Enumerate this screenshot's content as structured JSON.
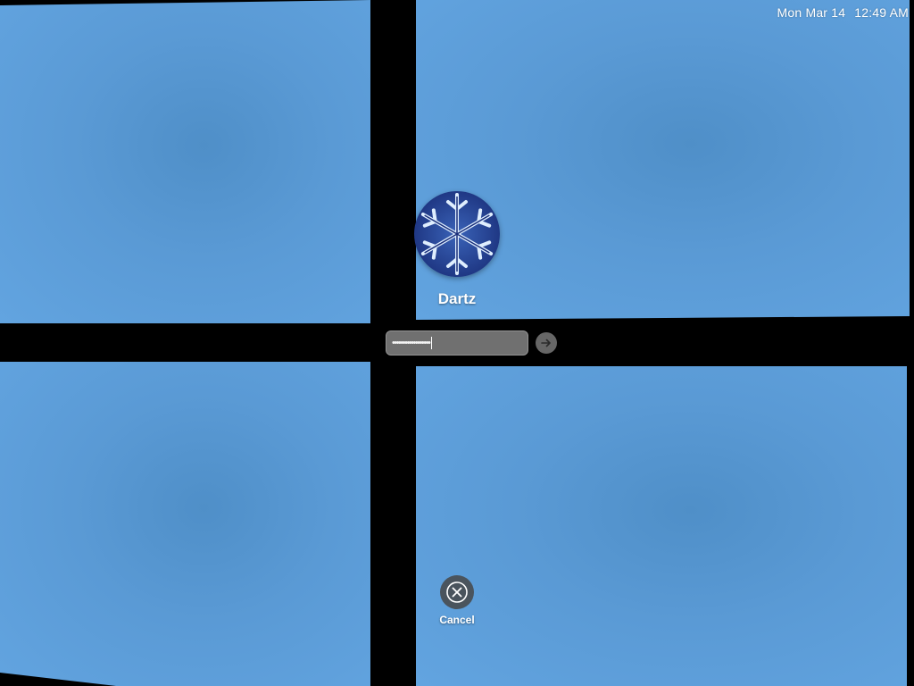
{
  "clock": {
    "date": "Mon Mar 14",
    "time": "12:49 AM"
  },
  "login": {
    "username": "Dartz",
    "avatar_icon": "snowflake-icon",
    "password_mask": "••••••••••••••••••",
    "submit_icon": "arrow-right-icon"
  },
  "cancel": {
    "label": "Cancel",
    "icon": "close-circle-icon"
  },
  "colors": {
    "wallpaper_blue": "#5a9ad5",
    "divider": "#000000"
  }
}
